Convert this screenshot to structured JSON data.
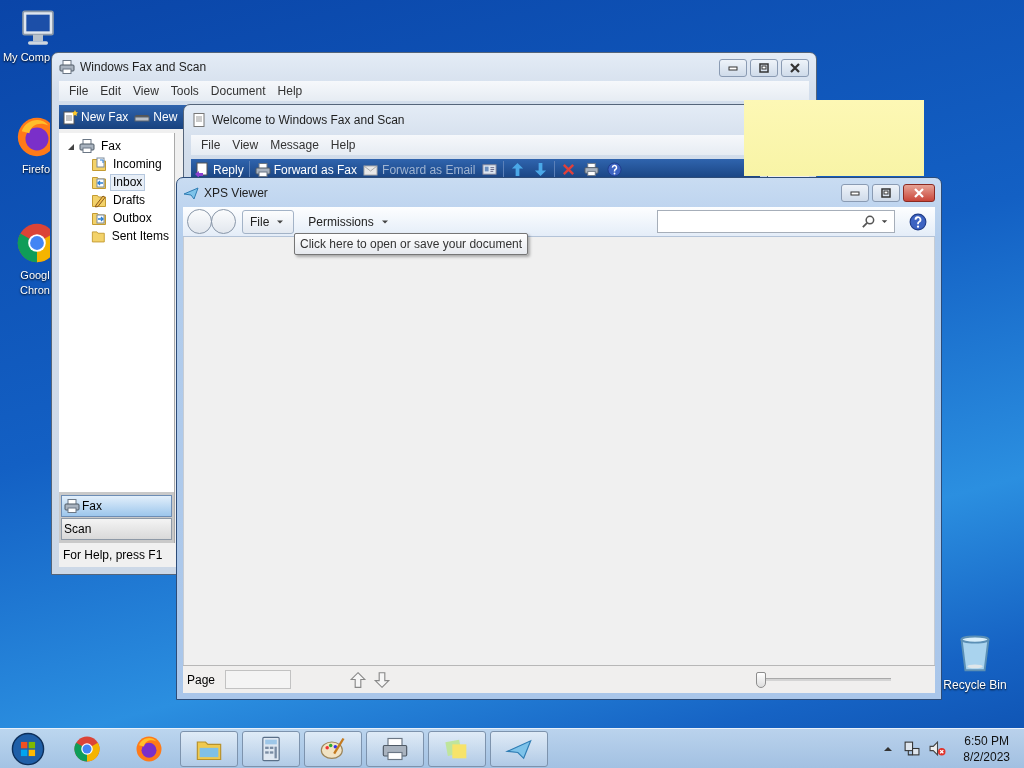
{
  "desktop_icons": [
    {
      "kind": "computer",
      "lines": [
        "My Comp"
      ]
    },
    {
      "kind": "firefox",
      "lines": [
        "Firefo"
      ]
    },
    {
      "kind": "chrome",
      "lines": [
        "Googl",
        "Chron"
      ]
    },
    {
      "kind": "recycle",
      "lines": [
        "Recycle Bin"
      ]
    }
  ],
  "fax_window": {
    "title": "Windows Fax and Scan",
    "menu": [
      "File",
      "Edit",
      "View",
      "Tools",
      "Document",
      "Help"
    ],
    "toolbar": [
      {
        "kind": "new_fax",
        "label": "New Fax"
      },
      {
        "kind": "new_scan",
        "label": "New"
      }
    ],
    "tree": [
      {
        "kind": "fax",
        "label": "Fax",
        "expanded": true,
        "selected": false,
        "children": [
          {
            "kind": "incoming",
            "label": "Incoming",
            "selected": false
          },
          {
            "kind": "inbox",
            "label": "Inbox",
            "selected": true
          },
          {
            "kind": "drafts",
            "label": "Drafts",
            "selected": false
          },
          {
            "kind": "outbox",
            "label": "Outbox",
            "selected": false
          },
          {
            "kind": "sent",
            "label": "Sent Items",
            "selected": false
          }
        ]
      }
    ],
    "nav_buttons": [
      {
        "kind": "fax",
        "label": "Fax",
        "selected": true
      },
      {
        "kind": "scan",
        "label": "Scan",
        "selected": false
      }
    ],
    "status_bar": "For Help, press F1"
  },
  "message_window": {
    "title": "Welcome to Windows Fax and Scan",
    "menu": [
      "File",
      "View",
      "Message",
      "Help"
    ],
    "toolbar": [
      {
        "kind": "reply",
        "label": "Reply",
        "disabled": false
      },
      {
        "kind": "forward_fax",
        "label": "Forward as Fax",
        "disabled": false
      },
      {
        "kind": "forward_email",
        "label": "Forward as Email",
        "disabled": true
      },
      {
        "kind": "contact"
      },
      {
        "kind": "up"
      },
      {
        "kind": "down"
      },
      {
        "kind": "delete"
      },
      {
        "kind": "print"
      },
      {
        "kind": "help"
      }
    ]
  },
  "xps_viewer": {
    "title": "XPS Viewer",
    "menu": [
      {
        "label": "File",
        "hovered": true
      },
      {
        "label": "Permissions",
        "hovered": false
      }
    ],
    "tooltip": "Click here to open or save your document",
    "page_label": "Page",
    "zoom": {
      "level": 0
    }
  },
  "taskbar": {
    "items": [
      {
        "kind": "start",
        "running": false
      },
      {
        "kind": "chrome",
        "running": false
      },
      {
        "kind": "firefox",
        "running": false
      },
      {
        "kind": "folder",
        "running": true
      },
      {
        "kind": "calculator",
        "running": true
      },
      {
        "kind": "paint",
        "running": true
      },
      {
        "kind": "fax",
        "running": true
      },
      {
        "kind": "notes",
        "running": true
      },
      {
        "kind": "xps",
        "running": true
      }
    ],
    "clock": {
      "time": "6:50 PM",
      "date": "8/2/2023"
    }
  }
}
